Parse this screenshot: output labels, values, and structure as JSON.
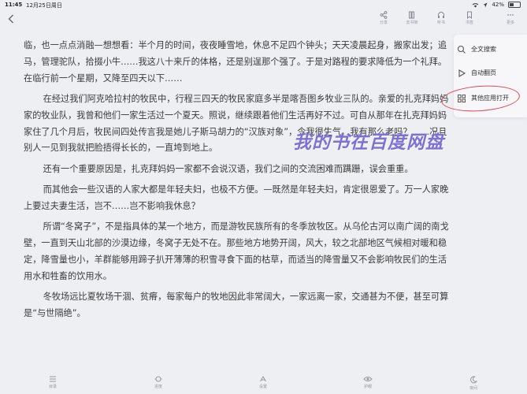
{
  "status": {
    "time": "11:45",
    "date": "12月25日周日",
    "battery": "42%"
  },
  "nav": {
    "back_icon": "chevron-left-icon"
  },
  "toolbar": [
    {
      "label": "分享",
      "icon": "share-icon"
    },
    {
      "label": "去书架",
      "icon": "bookshelf-icon"
    },
    {
      "label": "听书",
      "icon": "headphones-icon"
    },
    {
      "label": "书签",
      "icon": "bookmark-icon"
    },
    {
      "label": "更多",
      "icon": "more-icon"
    }
  ],
  "content": {
    "paragraphs": [
      "临，也一点点消融—想想看：半个月的时间，夜夜睡雪地，休息不足四个钟头；天天凌晨起身，搬家出发；追马，管理驼队，拾掇小牛……我这八十来斤的体格，还是别逞那个强了。于是对路程的要求降低为一个礼拜。在临行前一个星期，又降至四天以下……",
      "在经过我们阿克哈拉村的牧民中，行程三四天的牧民家庭多半是喀吾图乡牧业三队的。亲爱的扎克拜妈妈家的牧业队，我曾和他们一家生活过一个夏天。照说，继续跟着他们生活再好不过。可自从那年在扎克拜妈妈家住了几个月后，牧民间四处传言我是她儿子斯马胡力的“汉族对象”，令我很生气。我有那么老吗？……况且别人一见到我就把脸捂得长长的，一直垮到地上。",
      "还有一个重要原因是，扎克拜妈妈一家都不会说汉语，我们之间的交流困难而蹒跚，误会重重。",
      "而其他会一些汉语的人家大都是年轻夫妇，也极不方便。—既然是年轻夫妇，肯定很恩爱了。万一人家晚上要过夫妻生活，岂不……岂不影响我休息？",
      "所谓“冬窝子”，不是指具体的某一个地方，而是游牧民族所有的冬季放牧区。从乌伦古河以南广阔的南戈壁，一直到天山北部的沙漠边缘，冬窝子无处不在。那些地方地势开阔，风大，较之北部地区气候相对暖和稳定，降雪量也小，羊群能够用蹄子扒开薄薄的积雪寻食下面的枯草，而适当的降雪量又不会影响牧民们的生活用水和牲畜的饮用水。",
      "冬牧场远比夏牧场干涸、贫瘠，每家每户的牧地因此非常阔大，一家远离一家，交通甚为不便，甚至可算是“与世隔绝”。"
    ]
  },
  "menu": [
    {
      "label": "全文搜索",
      "icon": "search-icon"
    },
    {
      "label": "自动翻页",
      "icon": "play-icon"
    },
    {
      "label": "其他应用打开",
      "icon": "apps-grid-icon"
    }
  ],
  "watermark": "我的书在百度网盘",
  "bottom": [
    {
      "label": "目录",
      "icon": "list-icon"
    },
    {
      "label": "进度",
      "icon": "progress-icon"
    },
    {
      "label": "设置",
      "icon": "settings-icon"
    },
    {
      "label": "护眼",
      "icon": "eye-icon"
    },
    {
      "label": "夜间",
      "icon": "moon-icon"
    }
  ],
  "colors": {
    "background": "#eeeff3",
    "annotation_red": "#e04a5a",
    "watermark_purple": "#7f6fd6"
  }
}
